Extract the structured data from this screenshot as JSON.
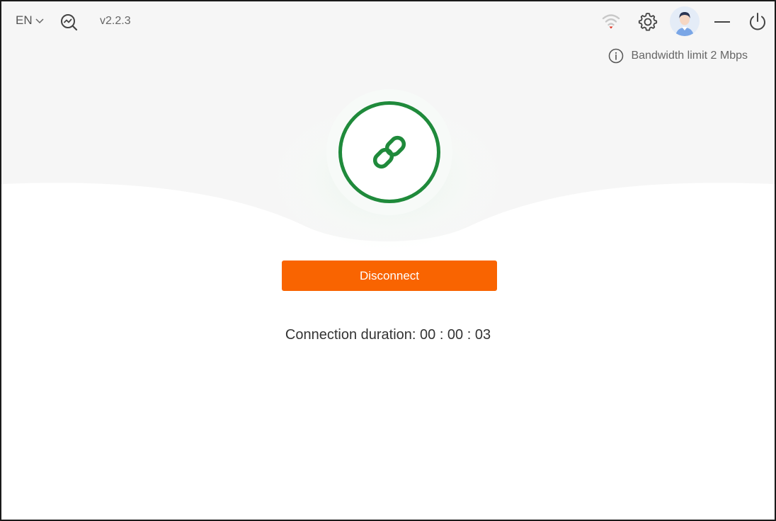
{
  "header": {
    "language": "EN",
    "version": "v2.2.3",
    "icons": {
      "language_dropdown": "chevron-down-icon",
      "stats": "search-chart-icon",
      "wifi": "wifi-icon",
      "settings": "gear-icon",
      "avatar": "user-avatar",
      "minimize": "minimize-icon",
      "power": "power-icon"
    }
  },
  "bandwidth": {
    "label": "Bandwidth limit 2 Mbps",
    "icon": "info-icon"
  },
  "connection": {
    "status_icon": "link-icon",
    "button_label": "Disconnect",
    "duration_label": "Connection duration: 00 : 00 : 03"
  },
  "colors": {
    "accent_orange": "#f96401",
    "connected_green": "#1f8a3b",
    "wifi_red": "#e0301e"
  }
}
